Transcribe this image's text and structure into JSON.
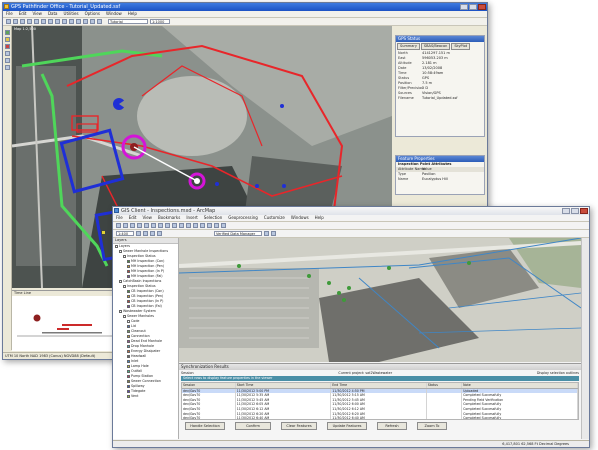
{
  "back": {
    "title": "GPS Pathfinder Office - Tutorial_Updated.ssf",
    "menu": [
      "File",
      "Edit",
      "View",
      "Data",
      "Utilities",
      "Options",
      "Window",
      "Help"
    ],
    "toolbar_combo": "Tutorial",
    "toolbar_combo2": "1:1000",
    "map_title": "Map 1:2,500",
    "time_panel_title": "Time Line",
    "status_text": "UTM 10 North  NAD 1983 (Conus)  NGVD88 (Default)",
    "gps_panel": {
      "title": "GPS Status",
      "tabs": [
        "Summary",
        "SBAS/Beacon",
        "SkyPlot"
      ],
      "rows": [
        {
          "k": "North",
          "v": "4141297.151 m"
        },
        {
          "k": "East",
          "v": "596053.203 m"
        },
        {
          "k": "Altitude",
          "v": "2.181 m"
        },
        {
          "k": "Date",
          "v": "13/02/2008"
        },
        {
          "k": "Time",
          "v": "10:58:49am"
        },
        {
          "k": "Status",
          "v": "GPS"
        },
        {
          "k": "Position",
          "v": "7.5 m"
        },
        {
          "k": "Filter/Precision",
          "v": "2 D"
        },
        {
          "k": "Sources",
          "v": "Vision/GPS"
        },
        {
          "k": "Filename",
          "v": "Tutorial_Updated.ssf"
        }
      ]
    },
    "feature_panel": {
      "title": "Feature Properties",
      "header": "Inspection Point Attributes",
      "cols": [
        "Attribute Name",
        "Value"
      ],
      "rows": [
        {
          "k": "Type",
          "v": "Pavilion"
        },
        {
          "k": "Name",
          "v": "Eucalyptus Hill"
        }
      ]
    },
    "colors": {
      "route_red": "#e8262a",
      "route_green": "#4fd65a",
      "boundary_blue": "#1f2fd6",
      "marker_magenta": "#d414d8"
    }
  },
  "front": {
    "title": "GIS Client - Inspections.mxd - ArcMap",
    "menu": [
      "File",
      "Edit",
      "View",
      "Bookmarks",
      "Insert",
      "Selection",
      "Geoprocessing",
      "Customize",
      "Windows",
      "Help"
    ],
    "toolbar_combo": "1:400",
    "toolbar_combo2": "Verified Data Manager",
    "toc_header": "Layers",
    "layers": [
      {
        "label": "Layers",
        "indent": 0,
        "color": "#ffffff"
      },
      {
        "label": "Sewer Manhole Inspections",
        "indent": 1,
        "color": "#ffffff"
      },
      {
        "label": "Inspection Status",
        "indent": 2,
        "color": "#ffffff"
      },
      {
        "label": "MH Inspection (Con)",
        "indent": 3,
        "color": "#3f9a3a"
      },
      {
        "label": "MH Inspection (Pen)",
        "indent": 3,
        "color": "#d6a12a"
      },
      {
        "label": "MH Inspection (In P)",
        "indent": 3,
        "color": "#cf3b36"
      },
      {
        "label": "MH Inspection (Fai)",
        "indent": 3,
        "color": "#7f4bb5"
      },
      {
        "label": "CatchBasin Inspections",
        "indent": 1,
        "color": "#ffffff"
      },
      {
        "label": "Inspection Status",
        "indent": 2,
        "color": "#ffffff"
      },
      {
        "label": "CB Inspection (Con)",
        "indent": 3,
        "color": "#3f9a3a"
      },
      {
        "label": "CB Inspection (Pen)",
        "indent": 3,
        "color": "#d6a12a"
      },
      {
        "label": "CB Inspection (In P)",
        "indent": 3,
        "color": "#cf3b36"
      },
      {
        "label": "CB Inspection (Fai)",
        "indent": 3,
        "color": "#7f4bb5"
      },
      {
        "label": "Wastewater System",
        "indent": 1,
        "color": "#ffffff"
      },
      {
        "label": "Sewer Manholes",
        "indent": 2,
        "color": "#ffffff"
      },
      {
        "label": "Code",
        "indent": 3,
        "color": "#ffffff"
      },
      {
        "label": "Lid",
        "indent": 3,
        "color": "#4f78c9"
      },
      {
        "label": "Cleanout",
        "indent": 3,
        "color": "#6aa85c"
      },
      {
        "label": "Connection",
        "indent": 3,
        "color": "#c9a13a"
      },
      {
        "label": "Dead End Manhole",
        "indent": 3,
        "color": "#a14b9c"
      },
      {
        "label": "Drop Manhole",
        "indent": 3,
        "color": "#49a8b8"
      },
      {
        "label": "Energy Dissipater",
        "indent": 3,
        "color": "#d76d3a"
      },
      {
        "label": "Headwall",
        "indent": 3,
        "color": "#6a6a6a"
      },
      {
        "label": "Inlet",
        "indent": 3,
        "color": "#3a8ad7"
      },
      {
        "label": "Lamp Hole",
        "indent": 3,
        "color": "#c9c93a"
      },
      {
        "label": "Outfall",
        "indent": 3,
        "color": "#3ac98a"
      },
      {
        "label": "Pump Station",
        "indent": 3,
        "color": "#c93a6d"
      },
      {
        "label": "Sewer Connection",
        "indent": 3,
        "color": "#8a8a3a"
      },
      {
        "label": "Spillway",
        "indent": 3,
        "color": "#3a5ac9"
      },
      {
        "label": "Tidegate",
        "indent": 3,
        "color": "#5c3ac9"
      },
      {
        "label": "Vent",
        "indent": 3,
        "color": "#9ac93a"
      }
    ],
    "sync_panel": {
      "title": "Synchronization Results",
      "label": "Session",
      "label2": "Current project: sat2Wastewater",
      "check": "Display selection outlines",
      "info": "Select rows to display feature properties in the viewer",
      "cols": [
        "Session",
        "Start Time",
        "End Time",
        "Status",
        "Note"
      ],
      "rows": [
        [
          "dev/Gov70",
          "11/30/2012 5:00 PM",
          "11/30/2012 4:50 PM",
          "",
          "Uploaded"
        ],
        [
          "dev/Gov70",
          "11/30/2012 5:35 AM",
          "11/30/2012 5:15 AM",
          "",
          "Completed Successfully"
        ],
        [
          "dev/Gov70",
          "11/30/2012 5:45 AM",
          "11/30/2012 5:45 AM",
          "",
          "Pending Field Verification"
        ],
        [
          "dev/Gov70",
          "11/30/2012 6:05 AM",
          "11/30/2012 6:00 AM",
          "",
          "Completed Successfully"
        ],
        [
          "dev/Gov70",
          "11/30/2012 6:12 AM",
          "11/30/2012 6:12 AM",
          "",
          "Completed Successfully"
        ],
        [
          "dev/Gov70",
          "11/30/2012 6:20 AM",
          "11/30/2012 6:20 AM",
          "",
          "Completed Successfully"
        ],
        [
          "dev/Gov70",
          "11/30/2012 6:40 AM",
          "11/30/2012 6:40 AM",
          "",
          "Completed Successfully"
        ]
      ],
      "buttons": [
        "Handle Selection",
        "Confirm",
        "Clear Features",
        "Update Features",
        "Refresh",
        "Zoom To"
      ]
    },
    "status_text": "6,417,801 62,568 Ft Decimal Degrees"
  }
}
